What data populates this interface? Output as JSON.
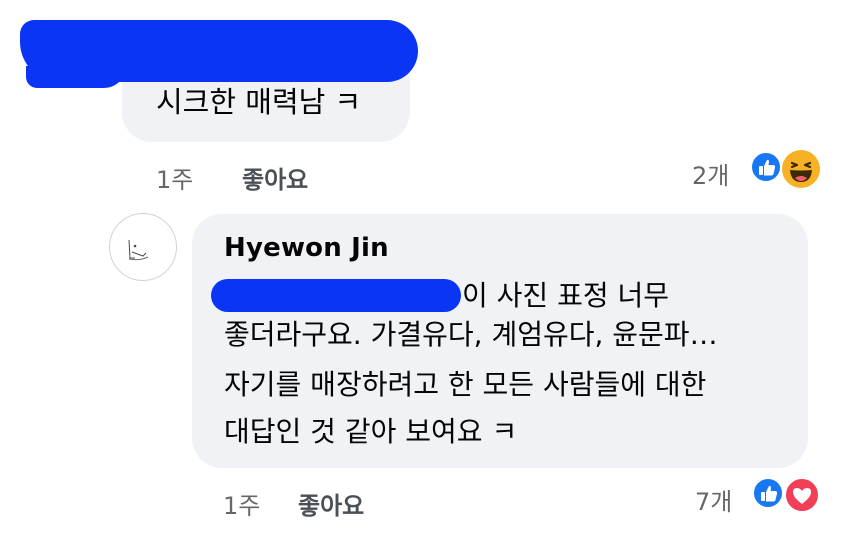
{
  "comment1": {
    "text": "시크한 매력남 ㅋ",
    "time": "1주",
    "like_label": "좋아요",
    "reaction_count": "2개",
    "reactions": [
      "like-icon",
      "haha-icon"
    ]
  },
  "comment2": {
    "author": "Hyewon Jin",
    "lines": [
      "이 사진 표정 너무",
      "좋더라구요. 가결유다, 계엄유다, 윤문파…",
      "자기를 매장하려고 한 모든 사람들에 대한",
      "대답인 것 같아 보여요 ㅋ"
    ],
    "time": "1주",
    "like_label": "좋아요",
    "reaction_count": "7개",
    "reactions": [
      "like-icon",
      "love-icon"
    ]
  },
  "colors": {
    "bubble": "#f0f2f5",
    "redaction": "#0a35f5",
    "like_blue": "#1877f2",
    "love_red": "#f33e58",
    "haha_yellow": "#f7b125",
    "meta_gray": "#65676b"
  }
}
